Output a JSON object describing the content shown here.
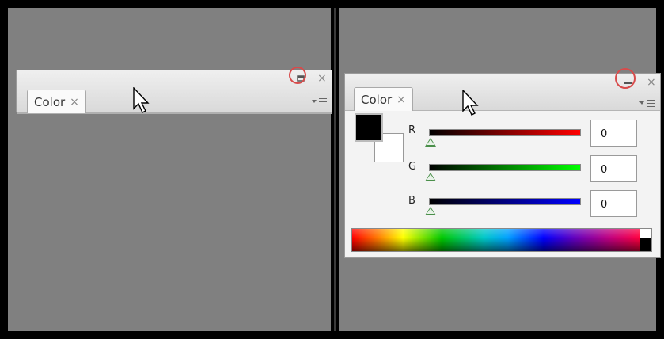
{
  "colors": {
    "workspace": "#808080",
    "frame": "#000000",
    "highlight_circle": "#d84b4b"
  },
  "left_panel": {
    "state": "minimized",
    "tab_label": "Color",
    "tab_close": "×",
    "control_icon": "restore-icon",
    "close_glyph": "×"
  },
  "right_panel": {
    "state": "expanded",
    "tab_label": "Color",
    "tab_close": "×",
    "control_icon": "minimize-icon",
    "close_glyph": "×",
    "swatches": {
      "foreground": "#000000",
      "background": "#ffffff"
    },
    "sliders": [
      {
        "label": "R",
        "value": "0",
        "level": 0,
        "color": "#ff0000"
      },
      {
        "label": "G",
        "value": "0",
        "level": 0,
        "color": "#00ff00"
      },
      {
        "label": "B",
        "value": "0",
        "level": 0,
        "color": "#0000ff"
      }
    ]
  }
}
